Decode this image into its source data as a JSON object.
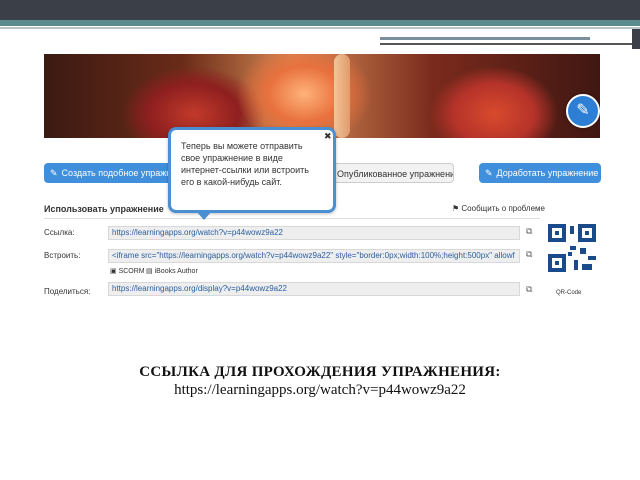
{
  "tooltip": {
    "text": "Теперь вы можете отправить свое упражнение в виде интернет-ссылки или встроить его в какой-нибудь сайт."
  },
  "buttons": {
    "create_similar": "Создать подобное упражнение",
    "published": "Опубликованное упражнение",
    "finish": "Доработать упражнение"
  },
  "section": {
    "title": "Использовать упражнение",
    "report": "Сообщить о проблеме"
  },
  "rows": {
    "link_label": "Ссылка:",
    "link_value": "https://learningapps.org/watch?v=p44wowz9a22",
    "embed_label": "Встроить:",
    "embed_value": "<iframe src=\"https://learningapps.org/watch?v=p44wowz9a22\" style=\"border:0px;width:100%;height:500px\" allowf",
    "scorm_label": "SCORM",
    "ibooks_label": "iBooks Author",
    "share_label": "Поделиться:",
    "share_value": "https://learningapps.org/display?v=p44wowz9a22"
  },
  "qr": {
    "label": "QR-Code"
  },
  "caption": {
    "title": "ССЫЛКА ДЛЯ ПРОХОЖДЕНИЯ УПРАЖНЕНИЯ:",
    "url": "https://learningapps.org/watch?v=p44wowz9a22"
  },
  "icons": {
    "edit": "pencil-check-icon",
    "close": "close-icon",
    "copy": "copy-icon",
    "flag": "flag-icon"
  },
  "colors": {
    "accent": "#3f8fdd",
    "tooltip_border": "#4a8fd1",
    "link": "#2a5fa0"
  }
}
